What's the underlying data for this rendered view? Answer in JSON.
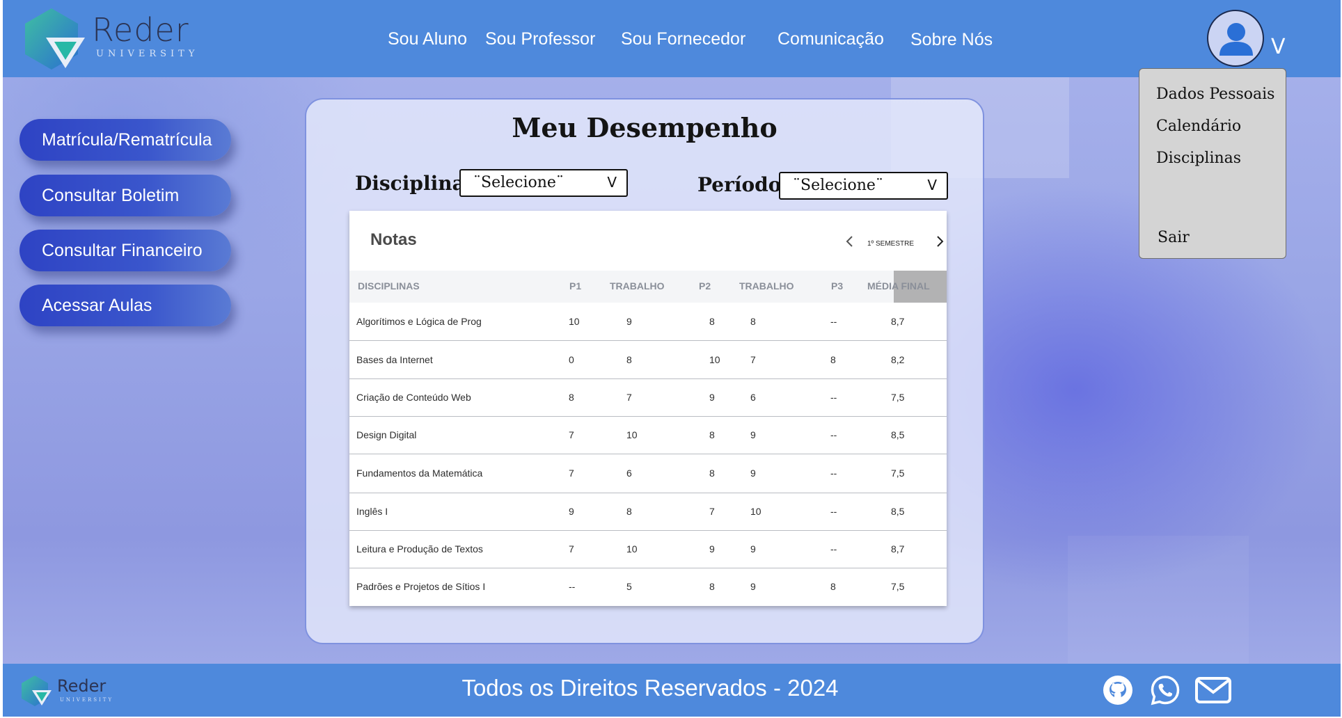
{
  "header": {
    "logo_text": "Reder",
    "logo_subtext": "UNIVERSITY",
    "nav": [
      {
        "label": "Sou Aluno"
      },
      {
        "label": "Sou Professor"
      },
      {
        "label": "Sou Fornecedor"
      },
      {
        "label": "Comunicação"
      },
      {
        "label": "Sobre Nós"
      }
    ],
    "user_chevron": "V"
  },
  "user_menu": {
    "items": [
      {
        "label": "Dados Pessoais"
      },
      {
        "label": "Calendário"
      },
      {
        "label": "Disciplinas"
      }
    ],
    "logout_label": "Sair"
  },
  "sidebar": {
    "buttons": [
      {
        "label": "Matrícula/Rematrícula"
      },
      {
        "label": "Consultar Boletim"
      },
      {
        "label": "Consultar Financeiro"
      },
      {
        "label": "Acessar Aulas"
      }
    ]
  },
  "main": {
    "title": "Meu Desempenho",
    "filters": {
      "disciplina_label": "Disciplina",
      "disciplina_value": "¨Selecione¨",
      "periodo_label": "Período",
      "periodo_value": "¨Selecione¨",
      "select_arrow": "V"
    },
    "grades": {
      "title": "Notas",
      "semester": "1º SEMESTRE",
      "columns": [
        "DISCIPLINAS",
        "P1",
        "TRABALHO",
        "P2",
        "TRABALHO",
        "P3",
        "MÉDIA FINAL"
      ],
      "rows": [
        [
          "Algorítimos e Lógica de Prog",
          "10",
          "9",
          "8",
          "8",
          "--",
          "8,7"
        ],
        [
          "Bases da Internet",
          "0",
          "8",
          "10",
          "7",
          "8",
          "8,2"
        ],
        [
          "Criação de Conteúdo Web",
          "8",
          "7",
          "9",
          "6",
          "--",
          "7,5"
        ],
        [
          "Design Digital",
          "7",
          "10",
          "8",
          "9",
          "--",
          "8,5"
        ],
        [
          "Fundamentos da Matemática",
          "7",
          "6",
          "8",
          "9",
          "--",
          "7,5"
        ],
        [
          "Inglês I",
          "9",
          "8",
          "7",
          "10",
          "--",
          "8,5"
        ],
        [
          "Leitura e Produção de Textos",
          "7",
          "10",
          "9",
          "9",
          "--",
          "8,7"
        ],
        [
          "Padrões e Projetos de Sítios I",
          "--",
          "5",
          "8",
          "9",
          "8",
          "7,5"
        ]
      ]
    }
  },
  "footer": {
    "logo_text": "Reder",
    "logo_subtext": "UNIVERSITY",
    "copyright": "Todos os Direitos Reservados - 2024",
    "icons": [
      "github-icon",
      "whatsapp-icon",
      "mail-icon"
    ]
  },
  "colors": {
    "header_bg": "#4e89dc",
    "button_blue": "#2e43c4",
    "menu_bg": "#d4d4d4"
  }
}
